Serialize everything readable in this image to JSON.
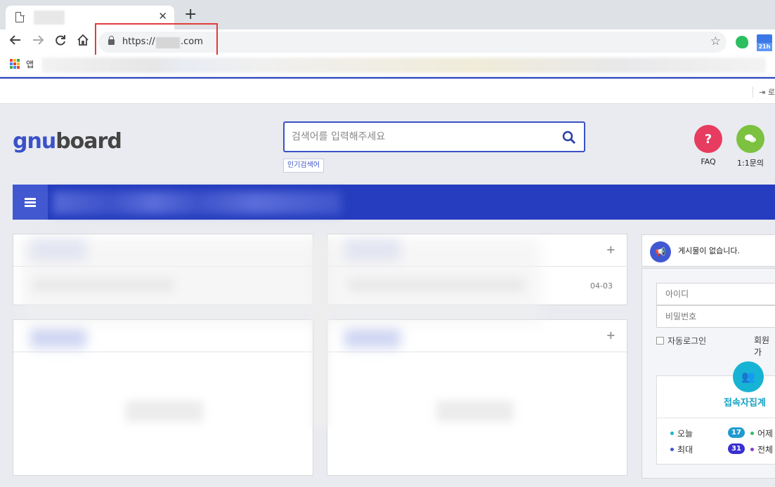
{
  "browser": {
    "tab_close": "✕",
    "new_tab": "+",
    "url_prefix": "https://",
    "url_suffix": ".com",
    "apps_label": "앱"
  },
  "top_bar": {
    "login_label": "로"
  },
  "search": {
    "placeholder": "검색어를 입력해주세요",
    "popular_label": "인기검색어"
  },
  "logo": {
    "part1": "gnu",
    "part2": "board"
  },
  "quick_links": [
    {
      "label": "FAQ",
      "symbol": "?",
      "color": "#e83b60"
    },
    {
      "label": "1:1문의",
      "symbol": "💬",
      "color": "#7cc140"
    }
  ],
  "panels": {
    "latest_date": "04-03"
  },
  "sidebar": {
    "notice": "게시물이 없습니다.",
    "id_placeholder": "아이디",
    "pw_placeholder": "비밀번호",
    "auto_login": "자동로그인",
    "join": "회원가",
    "stats_title": "접속자집계",
    "stats": [
      {
        "label": "오늘",
        "value": "17",
        "dot": "#17b3d4",
        "badge": "#1f9bd1"
      },
      {
        "label": "어제",
        "value": "",
        "dot": "#2fbf71"
      },
      {
        "label": "최대",
        "value": "31",
        "dot": "#4158d0",
        "badge": "#3a2fd0"
      },
      {
        "label": "전체",
        "value": "",
        "dot": "#8a3ec7"
      }
    ]
  },
  "colors": {
    "brand": "#253dbe",
    "accent": "#3a51c8",
    "highlight": "#e03c3c"
  }
}
